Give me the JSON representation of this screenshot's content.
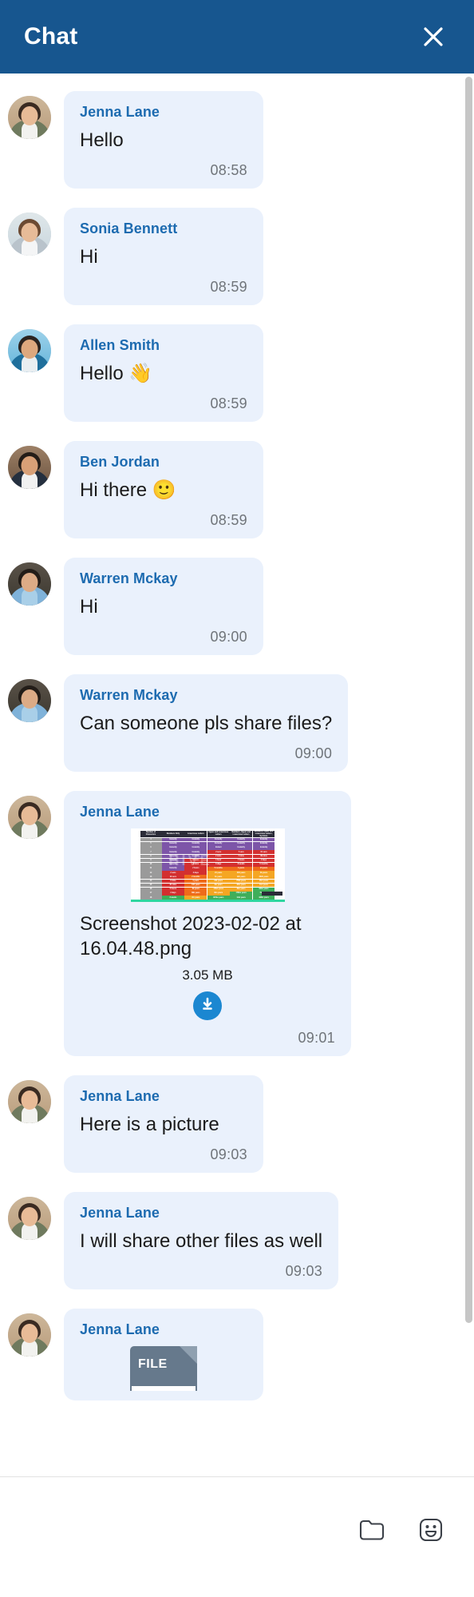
{
  "header": {
    "title": "Chat",
    "close_icon": "close-icon",
    "bg_color": "#17568f"
  },
  "theme": {
    "bubble_bg": "#eaf1fc",
    "sender_color": "#1d6bb0",
    "time_color": "#6f7479",
    "accent": "#1b87d1"
  },
  "messages": [
    {
      "sender": "Jenna Lane",
      "text": "Hello",
      "time": "08:58",
      "type": "text",
      "avatar": "jenna"
    },
    {
      "sender": "Sonia Bennett",
      "text": "Hi",
      "time": "08:59",
      "type": "text",
      "avatar": "sonia"
    },
    {
      "sender": "Allen Smith",
      "text": "Hello 👋",
      "time": "08:59",
      "type": "text",
      "avatar": "allen"
    },
    {
      "sender": "Ben Jordan",
      "text": "Hi there 🙂",
      "time": "08:59",
      "type": "text",
      "avatar": "ben"
    },
    {
      "sender": "Warren Mckay",
      "text": "Hi",
      "time": "09:00",
      "type": "text",
      "avatar": "warren"
    },
    {
      "sender": "Warren Mckay",
      "text": "Can someone pls share files?",
      "time": "09:00",
      "type": "text",
      "avatar": "warren"
    },
    {
      "sender": "Jenna Lane",
      "type": "attachment",
      "file_name": "Screenshot 2023-02-02 at 16.04.48.png",
      "file_size": "3.05 MB",
      "download_icon": "download-icon",
      "time": "09:01",
      "avatar": "jenna"
    },
    {
      "sender": "Jenna Lane",
      "text": "Here is a picture",
      "time": "09:03",
      "type": "text",
      "avatar": "jenna"
    },
    {
      "sender": "Jenna Lane",
      "text": "I will share other files as well",
      "time": "09:03",
      "type": "text",
      "avatar": "jenna"
    },
    {
      "sender": "Jenna Lane",
      "type": "file",
      "file_label": "FILE",
      "time": "",
      "avatar": "jenna"
    }
  ],
  "thumbnail_table": {
    "header": [
      "Number of Characters",
      "Numbers Only",
      "Lowercase Letters",
      "Upper and Lowercase Letters",
      "Numbers, Upper and Lowercase Letters",
      "Numbers, Upper and Lowercase Letters, Symbols"
    ],
    "watermark": "HIVE",
    "rows": [
      {
        "n": "4",
        "cells": [
          [
            "Instantly",
            "c-purple"
          ],
          [
            "Instantly",
            "c-purple"
          ],
          [
            "Instantly",
            "c-purple"
          ],
          [
            "Instantly",
            "c-purple"
          ],
          [
            "Instantly",
            "c-purple"
          ]
        ]
      },
      {
        "n": "5",
        "cells": [
          [
            "Instantly",
            "c-purple"
          ],
          [
            "Instantly",
            "c-purple"
          ],
          [
            "Instantly",
            "c-purple"
          ],
          [
            "Instantly",
            "c-purple"
          ],
          [
            "Instantly",
            "c-purple"
          ]
        ]
      },
      {
        "n": "6",
        "cells": [
          [
            "Instantly",
            "c-purple"
          ],
          [
            "Instantly",
            "c-purple"
          ],
          [
            "Instant",
            "c-purple"
          ],
          [
            "Instantly",
            "c-purple"
          ],
          [
            "Instantly",
            "c-purple"
          ]
        ]
      },
      {
        "n": "7",
        "cells": [
          [
            "Instantly",
            "c-purple"
          ],
          [
            "Instantly",
            "c-purple"
          ],
          [
            "2 secs",
            "c-red"
          ],
          [
            "7 secs",
            "c-red"
          ],
          [
            "31 secs",
            "c-red"
          ]
        ]
      },
      {
        "n": "8",
        "cells": [
          [
            "Instantly",
            "c-purple"
          ],
          [
            "Instantly",
            "c-purple"
          ],
          [
            "2 mins",
            "c-red"
          ],
          [
            "7 mins",
            "c-red"
          ],
          [
            "39 mins",
            "c-red"
          ]
        ]
      },
      {
        "n": "9",
        "cells": [
          [
            "Instantly",
            "c-purple"
          ],
          [
            "10 secs",
            "c-red"
          ],
          [
            "1 hour",
            "c-red"
          ],
          [
            "7 hours",
            "c-red"
          ],
          [
            "2 days",
            "c-red"
          ]
        ]
      },
      {
        "n": "10",
        "cells": [
          [
            "Instantly",
            "c-purple"
          ],
          [
            "4 mins",
            "c-red"
          ],
          [
            "3 days",
            "c-red"
          ],
          [
            "3 weeks",
            "c-red"
          ],
          [
            "5 months",
            "c-red"
          ]
        ]
      },
      {
        "n": "11",
        "cells": [
          [
            "Instantly",
            "c-purple"
          ],
          [
            "2 hours",
            "c-red"
          ],
          [
            "5 months",
            "c-orange"
          ],
          [
            "3 years",
            "c-orange"
          ],
          [
            "24 years",
            "c-orange"
          ]
        ]
      },
      {
        "n": "12",
        "cells": [
          [
            "2 secs",
            "c-red"
          ],
          [
            "2 days",
            "c-red"
          ],
          [
            "24 years",
            "c-amber"
          ],
          [
            "200 years",
            "c-amber"
          ],
          [
            "3k years",
            "c-amber"
          ]
        ]
      },
      {
        "n": "13",
        "cells": [
          [
            "19 secs",
            "c-red"
          ],
          [
            "2 months",
            "c-orange"
          ],
          [
            "1k years",
            "c-amber"
          ],
          [
            "12k years",
            "c-amber"
          ],
          [
            "202k years",
            "c-amber"
          ]
        ]
      },
      {
        "n": "14",
        "cells": [
          [
            "3 mins",
            "c-red"
          ],
          [
            "4 years",
            "c-orange"
          ],
          [
            "64k years",
            "c-amber"
          ],
          [
            "750k years",
            "c-amber"
          ],
          [
            "16m years",
            "c-amber"
          ]
        ]
      },
      {
        "n": "15",
        "cells": [
          [
            "32 mins",
            "c-red"
          ],
          [
            "100 years",
            "c-orange"
          ],
          [
            "3m years",
            "c-amber"
          ],
          [
            "46m years",
            "c-amber"
          ],
          [
            "1bn years",
            "c-amber"
          ]
        ]
      },
      {
        "n": "16",
        "cells": [
          [
            "5 hours",
            "c-red"
          ],
          [
            "3k years",
            "c-orange"
          ],
          [
            "173m years",
            "c-amber"
          ],
          [
            "3bn years",
            "c-amber"
          ],
          [
            "92bn years",
            "c-green"
          ]
        ]
      },
      {
        "n": "17",
        "cells": [
          [
            "2 days",
            "c-red"
          ],
          [
            "69k years",
            "c-orange"
          ],
          [
            "9bn years",
            "c-amber"
          ],
          [
            "179bn years",
            "c-green"
          ],
          [
            "7tn years",
            "c-green"
          ]
        ]
      },
      {
        "n": "18",
        "cells": [
          [
            "3 weeks",
            "c-green"
          ],
          [
            "2m years",
            "c-amber"
          ],
          [
            "467bn years",
            "c-green"
          ],
          [
            "11tn years",
            "c-green"
          ],
          [
            "438tn years",
            "c-green"
          ]
        ]
      }
    ]
  },
  "toolbar": {
    "attach_label": "folder-icon",
    "emoji_label": "emoji-icon"
  }
}
